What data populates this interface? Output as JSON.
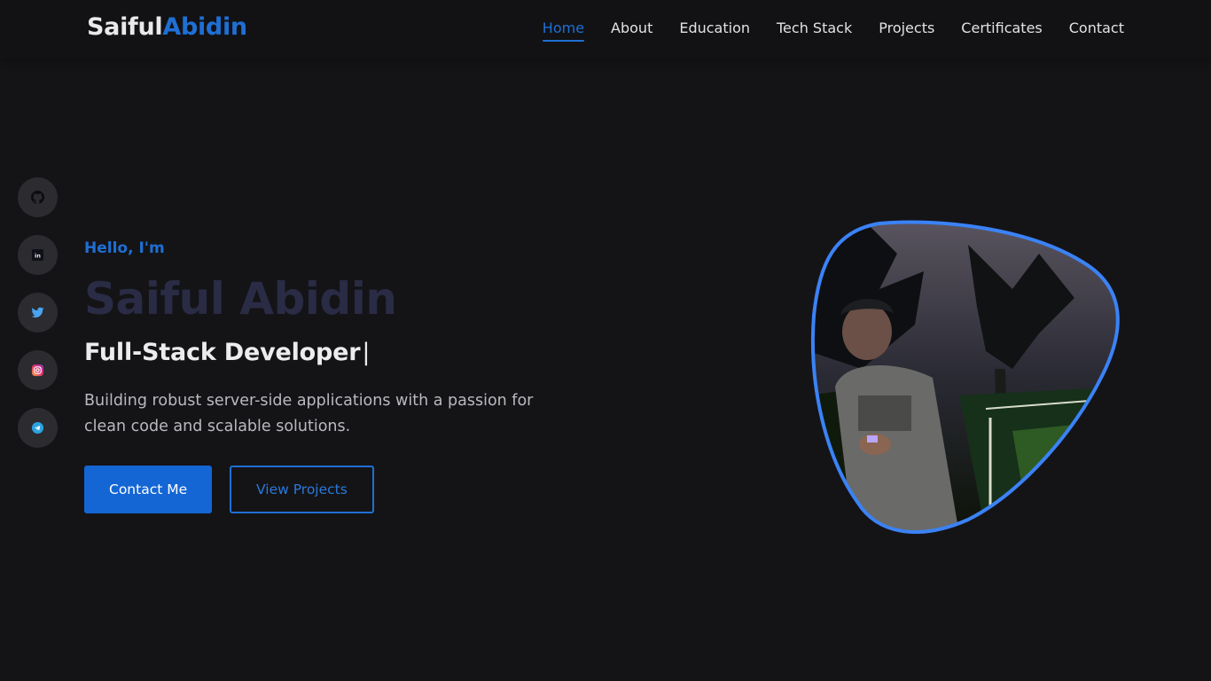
{
  "brand": {
    "first": "Saiful",
    "second": "Abidin"
  },
  "nav": {
    "items": [
      {
        "label": "Home",
        "active": true
      },
      {
        "label": "About"
      },
      {
        "label": "Education"
      },
      {
        "label": "Tech Stack"
      },
      {
        "label": "Projects"
      },
      {
        "label": "Certificates"
      },
      {
        "label": "Contact"
      }
    ]
  },
  "social": [
    {
      "icon": "github-icon"
    },
    {
      "icon": "linkedin-icon"
    },
    {
      "icon": "twitter-icon"
    },
    {
      "icon": "instagram-icon"
    },
    {
      "icon": "telegram-icon"
    }
  ],
  "hero": {
    "greeting": "Hello, I'm",
    "name": "Saiful Abidin",
    "role": "Full-Stack Developer",
    "cursor": "|",
    "description": "Building robust server-side applications with a passion for clean code and scalable solutions.",
    "primary_button": "Contact Me",
    "secondary_button": "View Projects"
  },
  "colors": {
    "accent": "#1f6fd4",
    "background": "#141417",
    "header": "#121214",
    "portrait_border": "#3b82f6"
  }
}
